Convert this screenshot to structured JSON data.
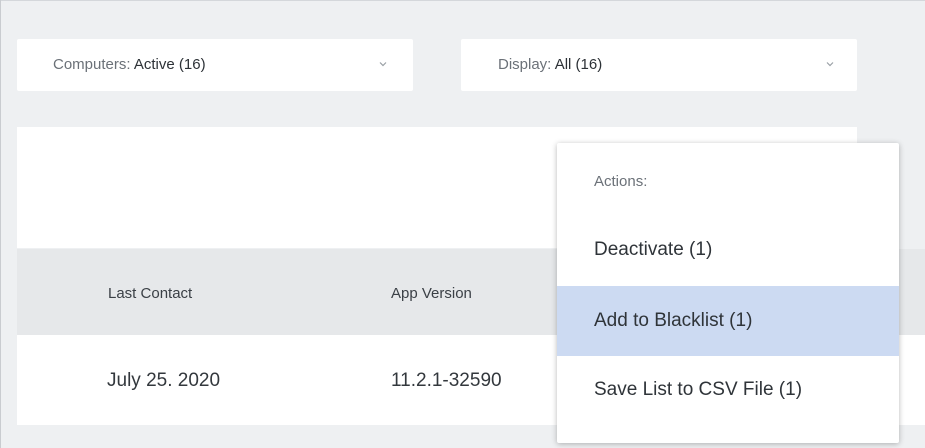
{
  "filters": {
    "computers": {
      "key": "Computers:",
      "value": "Active (16)",
      "icon": "chevron-down-icon"
    },
    "display": {
      "key": "Display:",
      "value": "All (16)",
      "icon": "chevron-down-icon"
    }
  },
  "table": {
    "columns": [
      "Last Contact",
      "App Version"
    ],
    "rows": [
      {
        "last_contact": "July 25. 2020",
        "app_version": "11.2.1-32590"
      }
    ]
  },
  "actions_menu": {
    "heading": "Actions:",
    "items": [
      {
        "label": "Deactivate (1)"
      },
      {
        "label": "Add to Blacklist (1)",
        "highlighted": true
      },
      {
        "label": "Save List to CSV File (1)"
      }
    ],
    "highlight_color": "#ccdaf2"
  },
  "colors": {
    "background": "#eef0f2",
    "header_band": "#e6e8ea",
    "surface": "#ffffff"
  }
}
